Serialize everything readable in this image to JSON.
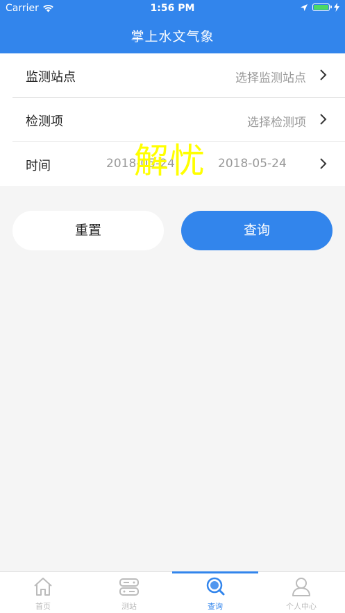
{
  "status_bar": {
    "carrier": "Carrier",
    "time": "1:56 PM",
    "icons": [
      "wifi-icon",
      "location-arrow-icon",
      "battery-icon",
      "charging-bolt-icon"
    ]
  },
  "header": {
    "title": "掌上水文气象"
  },
  "form": {
    "station": {
      "label": "监测站点",
      "placeholder": "选择监测站点"
    },
    "item": {
      "label": "检测项",
      "placeholder": "选择检测项"
    },
    "time": {
      "label": "时间",
      "start": "2018-05-24",
      "end": "2018-05-24"
    }
  },
  "watermark": "解忧",
  "buttons": {
    "reset": "重置",
    "query": "查询"
  },
  "tabbar": {
    "active_index": 2,
    "tabs": [
      {
        "label": "首页",
        "icon": "home-icon"
      },
      {
        "label": "测站",
        "icon": "station-icon"
      },
      {
        "label": "查询",
        "icon": "search-icon"
      },
      {
        "label": "个人中心",
        "icon": "user-icon"
      }
    ]
  },
  "colors": {
    "primary": "#3285ec",
    "background": "#f5f5f5",
    "watermark": "#ffff00",
    "inactive_tab": "#bbbbbb",
    "placeholder": "#999999"
  }
}
